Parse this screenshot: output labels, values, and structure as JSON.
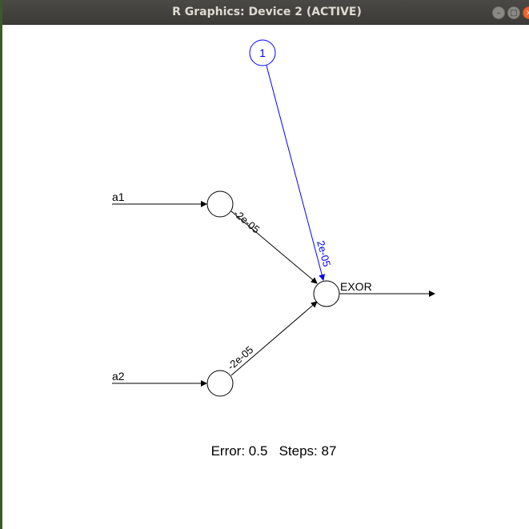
{
  "window": {
    "title": "R Graphics: Device 2 (ACTIVE)",
    "buttons": {
      "minimize_icon": "minimize-icon",
      "maximize_icon": "maximize-icon",
      "close_icon": "close-icon"
    }
  },
  "network": {
    "bias_node_label": "1",
    "input_labels": [
      "a1",
      "a2"
    ],
    "output_label": "EXOR",
    "weights": {
      "a1_to_output": "-2e-05",
      "a2_to_output": "-2e-05",
      "bias_to_output": "2e-05"
    },
    "colors": {
      "main": "#000000",
      "bias": "#0000ff"
    }
  },
  "stats": {
    "text": "Error: 0.5   Steps: 87"
  }
}
